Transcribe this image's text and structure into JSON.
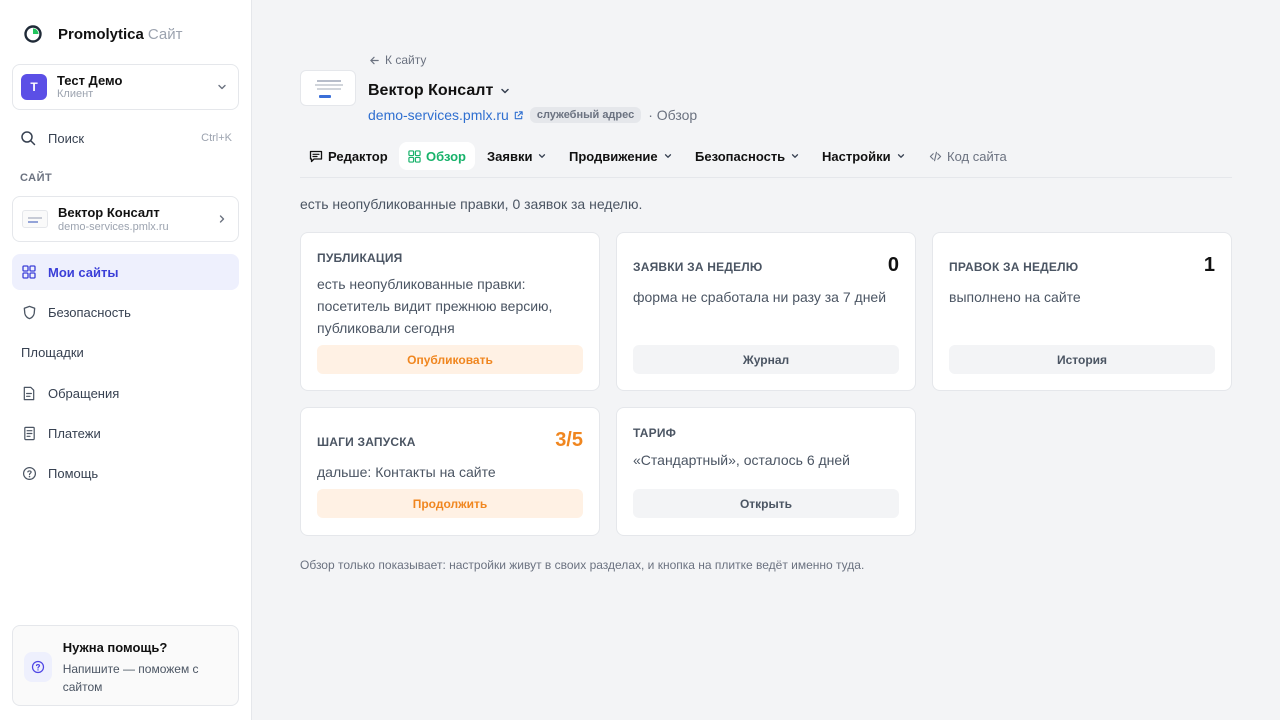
{
  "brand": {
    "name": "Promolytica",
    "suffix": "Сайт"
  },
  "account": {
    "initial": "Т",
    "name": "Тест Демо",
    "role": "Клиент"
  },
  "search": {
    "label": "Поиск",
    "shortcut": "Ctrl+K"
  },
  "sidebar": {
    "section_label": "САЙТ",
    "site": {
      "name": "Вектор Консалт",
      "url": "demo-services.pmlx.ru"
    },
    "items": [
      {
        "label": "Мои сайты",
        "icon": "grid-icon",
        "active": true
      },
      {
        "label": "Безопасность",
        "icon": "shield-icon"
      },
      {
        "label": "Площадки",
        "icon": ""
      },
      {
        "label": "Обращения",
        "icon": "document-icon"
      },
      {
        "label": "Платежи",
        "icon": "receipt-icon"
      },
      {
        "label": "Помощь",
        "icon": "question-icon"
      }
    ],
    "help": {
      "title": "Нужна помощь?",
      "text": "Напишите — поможем с сайтом"
    }
  },
  "header": {
    "back_label": "К сайту",
    "site_title": "Вектор Консалт",
    "url": "demo-services.pmlx.ru",
    "badge": "служебный адрес",
    "crumb": "· Обзор"
  },
  "tabs": [
    {
      "label": "Редактор",
      "icon": "message-icon"
    },
    {
      "label": "Обзор",
      "icon": "grid-icon",
      "active": true
    },
    {
      "label": "Заявки",
      "dropdown": true
    },
    {
      "label": "Продвижение",
      "dropdown": true
    },
    {
      "label": "Безопасность",
      "dropdown": true
    },
    {
      "label": "Настройки",
      "dropdown": true
    },
    {
      "label": "Код сайта",
      "icon": "code-icon"
    }
  ],
  "summary": "есть неопубликованные правки, 0 заявок за неделю.",
  "cards": {
    "publish": {
      "title": "ПУБЛИКАЦИЯ",
      "desc": "есть неопубликованные правки: посетитель видит прежнюю версию, публиковали сегодня",
      "button": "Опубликовать"
    },
    "requests": {
      "title": "ЗАЯВКИ ЗА НЕДЕЛЮ",
      "value": "0",
      "desc": "форма не сработала ни разу за 7 дней",
      "button": "Журнал"
    },
    "edits": {
      "title": "ПРАВОК ЗА НЕДЕЛЮ",
      "value": "1",
      "desc": "выполнено на сайте",
      "button": "История"
    },
    "launch": {
      "title": "ШАГИ ЗАПУСКА",
      "value": "3/5",
      "desc": "дальше: Контакты на сайте",
      "button": "Продолжить"
    },
    "tariff": {
      "title": "ТАРИФ",
      "desc": "«Стандартный», осталось 6 дней",
      "button": "Открыть"
    }
  },
  "footnote": "Обзор только показывает: настройки живут в своих разделах, и кнопка на плитке ведёт именно туда.",
  "colors": {
    "accent": "#5b4fe6",
    "active_tab": "#17b26a",
    "orange": "#f0861f",
    "link": "#2f6fd0"
  }
}
